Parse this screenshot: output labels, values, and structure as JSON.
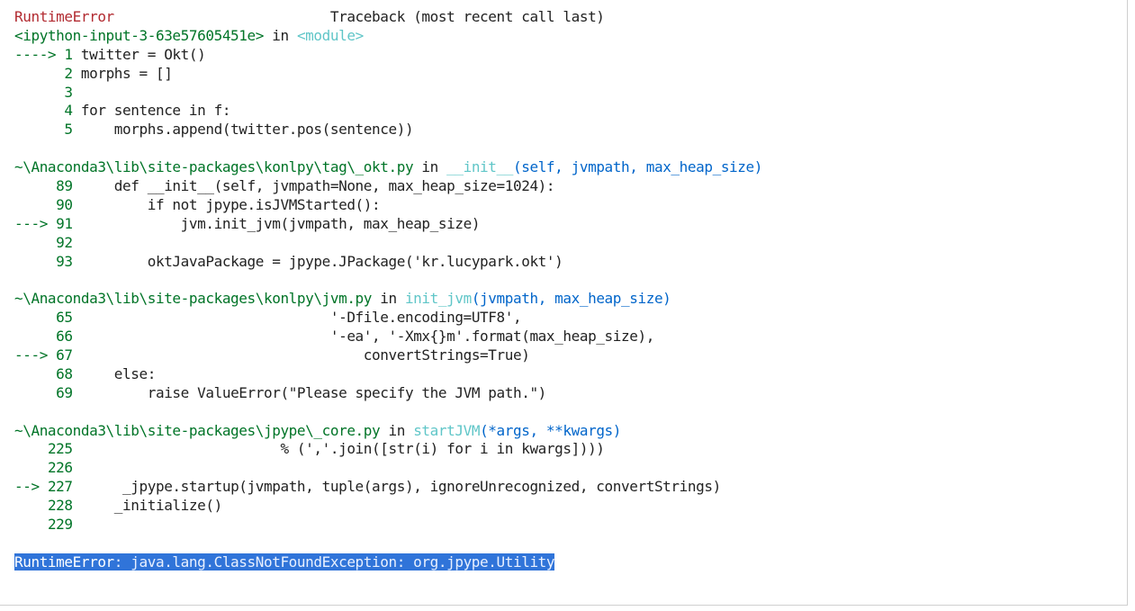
{
  "header": {
    "error_name": "RuntimeError",
    "traceback_title": "Traceback (most recent call last)"
  },
  "frames": [
    {
      "file": "<ipython-input-3-63e57605451e>",
      "in_word": "in",
      "func": "<module>",
      "args": "",
      "lines": [
        {
          "arrow": "---->",
          "num": "1",
          "code": "twitter = Okt()"
        },
        {
          "arrow": "",
          "num": "2",
          "code": "morphs = []"
        },
        {
          "arrow": "",
          "num": "3",
          "code": ""
        },
        {
          "arrow": "",
          "num": "4",
          "code": "for sentence in f:"
        },
        {
          "arrow": "",
          "num": "5",
          "code": "    morphs.append(twitter.pos(sentence))"
        }
      ]
    },
    {
      "file": "~\\Anaconda3\\lib\\site-packages\\konlpy\\tag\\_okt.py",
      "in_word": "in",
      "func": "__init__",
      "args": "(self, jvmpath, max_heap_size)",
      "lines": [
        {
          "arrow": "",
          "num": "89",
          "code": "    def __init__(self, jvmpath=None, max_heap_size=1024):"
        },
        {
          "arrow": "",
          "num": "90",
          "code": "        if not jpype.isJVMStarted():"
        },
        {
          "arrow": "--->",
          "num": "91",
          "code": "            jvm.init_jvm(jvmpath, max_heap_size)"
        },
        {
          "arrow": "",
          "num": "92",
          "code": ""
        },
        {
          "arrow": "",
          "num": "93",
          "code": "        oktJavaPackage = jpype.JPackage('kr.lucypark.okt')"
        }
      ]
    },
    {
      "file": "~\\Anaconda3\\lib\\site-packages\\konlpy\\jvm.py",
      "in_word": "in",
      "func": "init_jvm",
      "args": "(jvmpath, max_heap_size)",
      "lines": [
        {
          "arrow": "",
          "num": "65",
          "code": "                              '-Dfile.encoding=UTF8',"
        },
        {
          "arrow": "",
          "num": "66",
          "code": "                              '-ea', '-Xmx{}m'.format(max_heap_size),"
        },
        {
          "arrow": "--->",
          "num": "67",
          "code": "                                  convertStrings=True)"
        },
        {
          "arrow": "",
          "num": "68",
          "code": "    else:"
        },
        {
          "arrow": "",
          "num": "69",
          "code": "        raise ValueError(\"Please specify the JVM path.\")"
        }
      ]
    },
    {
      "file": "~\\Anaconda3\\lib\\site-packages\\jpype\\_core.py",
      "in_word": "in",
      "func": "startJVM",
      "args": "(*args, **kwargs)",
      "lines": [
        {
          "arrow": "",
          "num": "225",
          "code": "                        % (','.join([str(i) for i in kwargs])))"
        },
        {
          "arrow": "",
          "num": "226",
          "code": ""
        },
        {
          "arrow": "-->",
          "num": "227",
          "code": "     _jpype.startup(jvmpath, tuple(args), ignoreUnrecognized, convertStrings)"
        },
        {
          "arrow": "",
          "num": "228",
          "code": "    _initialize()"
        },
        {
          "arrow": "",
          "num": "229",
          "code": ""
        }
      ]
    }
  ],
  "final_error": {
    "name": "RuntimeError",
    "message": ": java.lang.ClassNotFoundException: org.jpype.Utility"
  }
}
